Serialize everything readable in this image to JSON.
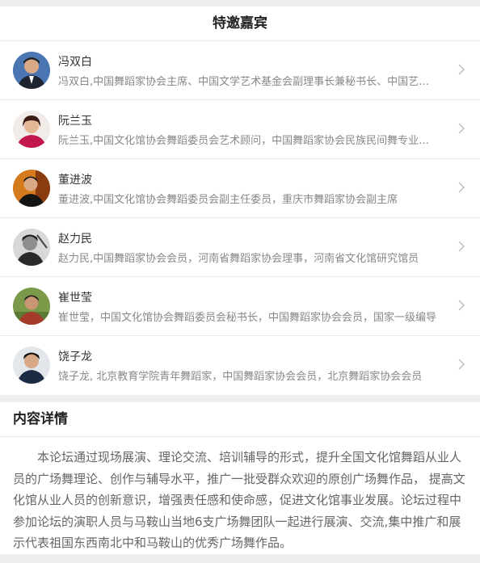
{
  "guests_section": {
    "title": "特邀嘉宾",
    "guests": [
      {
        "name": "冯双白",
        "desc": "冯双白,中国舞蹈家协会主席、中国文学艺术基金会副理事长兼秘书长、中国艺术研究院研究员"
      },
      {
        "name": "阮兰玉",
        "desc": "阮兰玉,中国文化馆协会舞蹈委员会艺术顾问，中国舞蹈家协会民族民间舞专业委员会委员"
      },
      {
        "name": "董进波",
        "desc": "董进波,中国文化馆协会舞蹈委员会副主任委员，重庆市舞蹈家协会副主席"
      },
      {
        "name": "赵力民",
        "desc": "赵力民,中国舞蹈家协会会员，河南省舞蹈家协会理事，河南省文化馆研究馆员"
      },
      {
        "name": "崔世莹",
        "desc": "崔世莹，中国文化馆协会舞蹈委员会秘书长，中国舞蹈家协会会员，国家一级编导"
      },
      {
        "name": "饶子龙",
        "desc": "饶子龙, 北京教育学院青年舞蹈家，中国舞蹈家协会会员，北京舞蹈家协会会员"
      }
    ]
  },
  "details_section": {
    "title": "内容详情",
    "body": "本论坛通过现场展演、理论交流、培训辅导的形式，提升全国文化馆舞蹈从业人员的广场舞理论、创作与辅导水平，推广一批受群众欢迎的原创广场舞作品， 提高文化馆从业人员的创新意识，增强责任感和使命感，促进文化馆事业发展。论坛过程中参加论坛的演职人员与马鞍山当地6支广场舞团队一起进行展演、交流,集中推广和展示代表祖国东西南北中和马鞍山的优秀广场舞作品。"
  },
  "colors": {
    "title_text": "#222222",
    "name_text": "#333333",
    "desc_text": "#888888",
    "body_text": "#666666",
    "divider": "#ececec",
    "background": "#eeeeee"
  },
  "icons": {
    "row_arrow": "chevron-right-icon"
  }
}
